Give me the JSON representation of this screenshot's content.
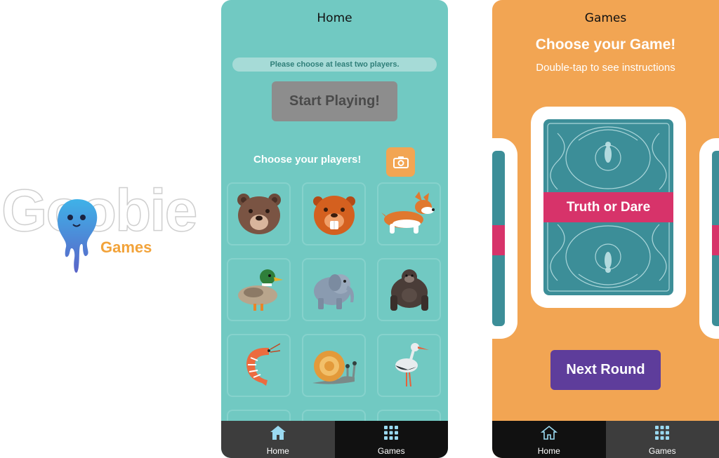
{
  "logo": {
    "wordmark": "Goobie",
    "subtitle": "Games"
  },
  "phone_home": {
    "title": "Home",
    "notice": "Please choose at least two players.",
    "start_button": "Start Playing!",
    "choose_players_label": "Choose your players!",
    "camera_icon": "camera-icon",
    "players": [
      {
        "animal": "bear"
      },
      {
        "animal": "beaver"
      },
      {
        "animal": "corgi"
      },
      {
        "animal": "duck"
      },
      {
        "animal": "elephant"
      },
      {
        "animal": "gorilla"
      },
      {
        "animal": "shrimp"
      },
      {
        "animal": "snail"
      },
      {
        "animal": "stork"
      }
    ],
    "tabs": [
      {
        "label": "Home",
        "icon": "home-icon",
        "active": true
      },
      {
        "label": "Games",
        "icon": "grid-icon",
        "active": false
      }
    ],
    "colors": {
      "background": "#71c9c2",
      "camera_button": "#f2a553",
      "tabbar_active": "#3d3d3d",
      "tabbar_inactive": "#111111"
    }
  },
  "phone_games": {
    "title": "Games",
    "headline": "Choose your Game!",
    "subheadline": "Double-tap to see instructions",
    "card_label": "Truth or Dare",
    "next_button": "Next Round",
    "tabs": [
      {
        "label": "Home",
        "icon": "home-icon",
        "active": false
      },
      {
        "label": "Games",
        "icon": "grid-icon",
        "active": true
      }
    ],
    "colors": {
      "background": "#f2a553",
      "card": "#3c8e98",
      "card_band": "#d7336a",
      "next_button": "#5e3d9b"
    }
  }
}
